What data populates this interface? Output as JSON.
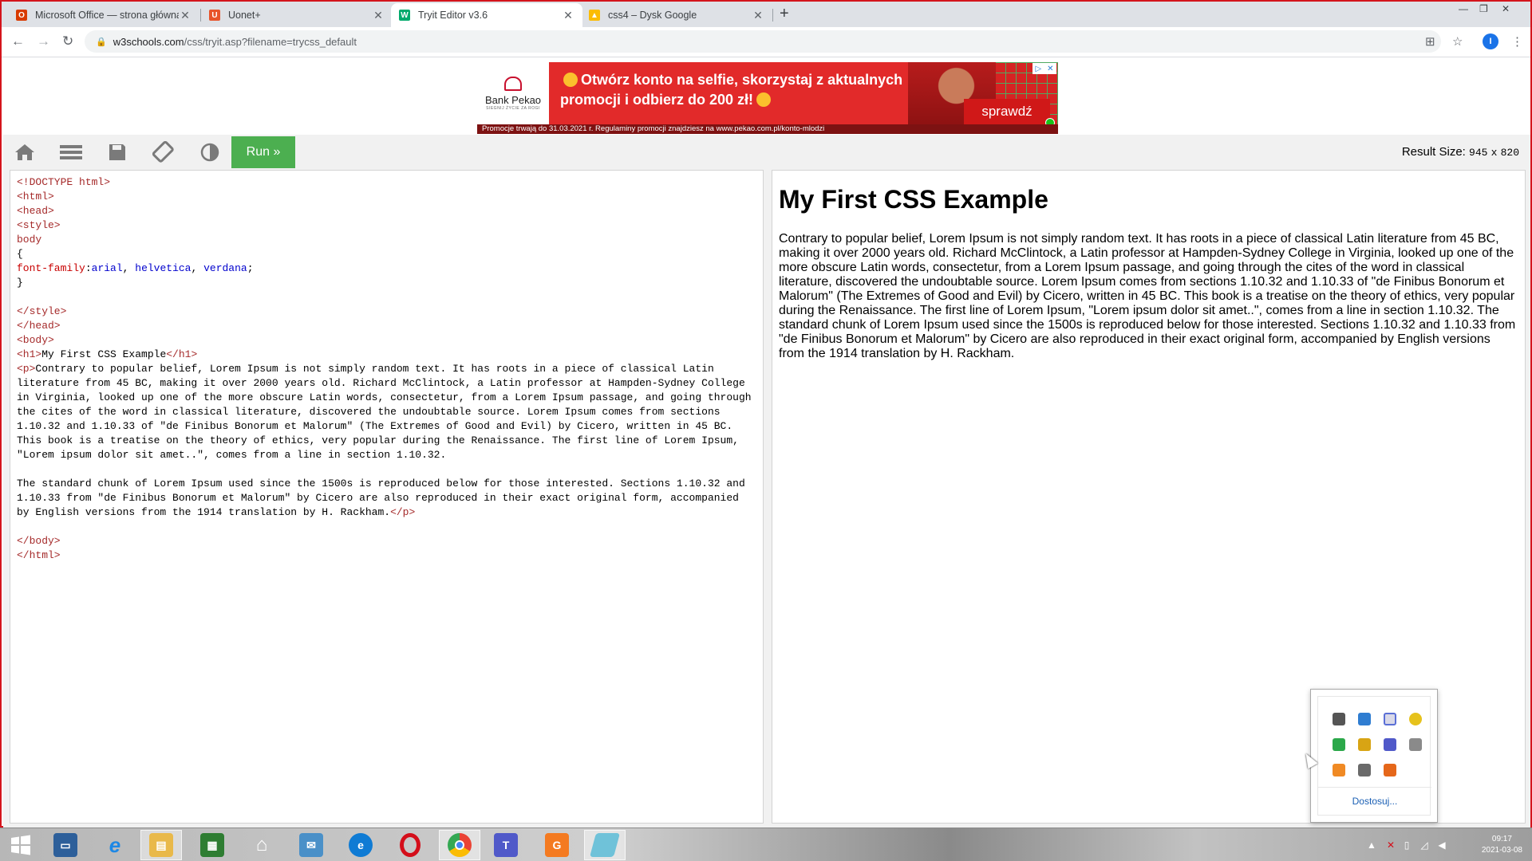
{
  "browser": {
    "tabs": [
      {
        "title": "Microsoft Office — strona główna",
        "favicon": "office-icon",
        "color": "#d83b01"
      },
      {
        "title": "Uonet+",
        "favicon": "uonet-icon",
        "color": "#e8542b"
      },
      {
        "title": "Tryit Editor v3.6",
        "favicon": "w3schools-icon",
        "color": "#04aa6d"
      },
      {
        "title": "css4 – Dysk Google",
        "favicon": "google-drive-icon",
        "color": "#fbbc04"
      }
    ],
    "new_tab_label": "+",
    "url_host": "w3schools.com",
    "url_path": "/css/tryit.asp?filename=trycss_default",
    "profile_initial": "I"
  },
  "ad": {
    "brand": "Bank Pekao",
    "brand_tagline": "SIEGNIJ ŻYCIE ZA ROGI",
    "headline_1": "Otwórz konto na selfie, skorzystaj z aktualnych",
    "headline_2": "promocji i odbierz do 200 zł!",
    "cta": "sprawdź",
    "footer": "Promocje trwają do 31.03.2021 r. Regulaminy promocji znajdziesz na www.pekao.com.pl/konto-mlodzi",
    "choices_icons": [
      "adchoices-icon",
      "close-icon"
    ]
  },
  "toolbar": {
    "run_label": "Run »",
    "result_size_label": "Result Size:",
    "result_width": "945",
    "result_x": "x",
    "result_height": "820",
    "icons": [
      "home-icon",
      "menu-icon",
      "save-icon",
      "rotate-icon",
      "theme-icon"
    ]
  },
  "editor": {
    "lines": {
      "doctype": "<!DOCTYPE html>",
      "html_open": "<html>",
      "head_open": "<head>",
      "style_open": "<style>",
      "selector": "body",
      "brace_open": "{",
      "prop": "font-family",
      "colon": ":",
      "val1": "arial",
      "comma1": ", ",
      "val2": "helvetica",
      "comma2": ", ",
      "val3": "verdana",
      "semi": ";",
      "brace_close": "}",
      "style_close": "</style>",
      "head_close": "</head>",
      "body_open": "<body>",
      "h1_open": "<h1>",
      "h1_text": "My First CSS Example",
      "h1_close": "</h1>",
      "p_open": "<p>",
      "p_text_1": "Contrary to popular belief, Lorem Ipsum is not simply random text. It has roots in a piece of classical Latin literature from 45 BC, making it over 2000 years old. Richard McClintock, a Latin professor at Hampden-Sydney College in Virginia, looked up one of the more obscure Latin words, consectetur, from a Lorem Ipsum passage, and going through the cites of the word in classical literature, discovered the undoubtable source. Lorem Ipsum comes from sections 1.10.32 and 1.10.33 of \"de Finibus Bonorum et Malorum\" (The Extremes of Good and Evil) by Cicero, written in 45 BC. This book is a treatise on the theory of ethics, very popular during the Renaissance. The first line of Lorem Ipsum, \"Lorem ipsum dolor sit amet..\", comes from a line in section 1.10.32.",
      "p_text_2": "The standard chunk of Lorem Ipsum used since the 1500s is reproduced below for those interested. Sections 1.10.32 and 1.10.33 from \"de Finibus Bonorum et Malorum\" by Cicero are also reproduced in their exact original form, accompanied by English versions from the 1914 translation by H. Rackham.",
      "p_close": "</p>",
      "body_close": "</body>",
      "html_close": "</html>"
    }
  },
  "result": {
    "heading": "My First CSS Example",
    "paragraph": "Contrary to popular belief, Lorem Ipsum is not simply random text. It has roots in a piece of classical Latin literature from 45 BC, making it over 2000 years old. Richard McClintock, a Latin professor at Hampden-Sydney College in Virginia, looked up one of the more obscure Latin words, consectetur, from a Lorem Ipsum passage, and going through the cites of the word in classical literature, discovered the undoubtable source. Lorem Ipsum comes from sections 1.10.32 and 1.10.33 of \"de Finibus Bonorum et Malorum\" (The Extremes of Good and Evil) by Cicero, written in 45 BC. This book is a treatise on the theory of ethics, very popular during the Renaissance. The first line of Lorem Ipsum, \"Lorem ipsum dolor sit amet..\", comes from a line in section 1.10.32. The standard chunk of Lorem Ipsum used since the 1500s is reproduced below for those interested. Sections 1.10.32 and 1.10.33 from \"de Finibus Bonorum et Malorum\" by Cicero are also reproduced in their exact original form, accompanied by English versions from the 1914 translation by H. Rackham."
  },
  "tray_popup": {
    "customize_label": "Dostosuj...",
    "icons": [
      "lenovo-icon",
      "network-drive-icon",
      "bluetooth-icon",
      "update-icon",
      "defender-icon",
      "box-icon",
      "teams-icon",
      "usb-icon",
      "backup-icon",
      "printer-icon",
      "pdf-icon"
    ]
  },
  "taskbar": {
    "apps": [
      {
        "name": "start-button",
        "color": "#ffffff"
      },
      {
        "name": "lenovo-app",
        "color": "#2d5f9a"
      },
      {
        "name": "internet-explorer",
        "color": "#1e88e5"
      },
      {
        "name": "file-explorer",
        "color": "#e9b94a"
      },
      {
        "name": "microsoft-store",
        "color": "#2e7d32"
      },
      {
        "name": "home-app",
        "color": "#ffffff"
      },
      {
        "name": "mail-app",
        "color": "#4a90c8"
      },
      {
        "name": "edge-browser",
        "color": "#0f7bd4"
      },
      {
        "name": "opera-browser",
        "color": "#d40e1a"
      },
      {
        "name": "chrome-browser",
        "color": "#34a853"
      },
      {
        "name": "teams-app",
        "color": "#5059c9"
      },
      {
        "name": "pdf-app",
        "color": "#f47a20"
      },
      {
        "name": "notepad-app",
        "color": "#6fc2d9"
      }
    ],
    "time": "09:17",
    "date": "2021-03-08"
  }
}
